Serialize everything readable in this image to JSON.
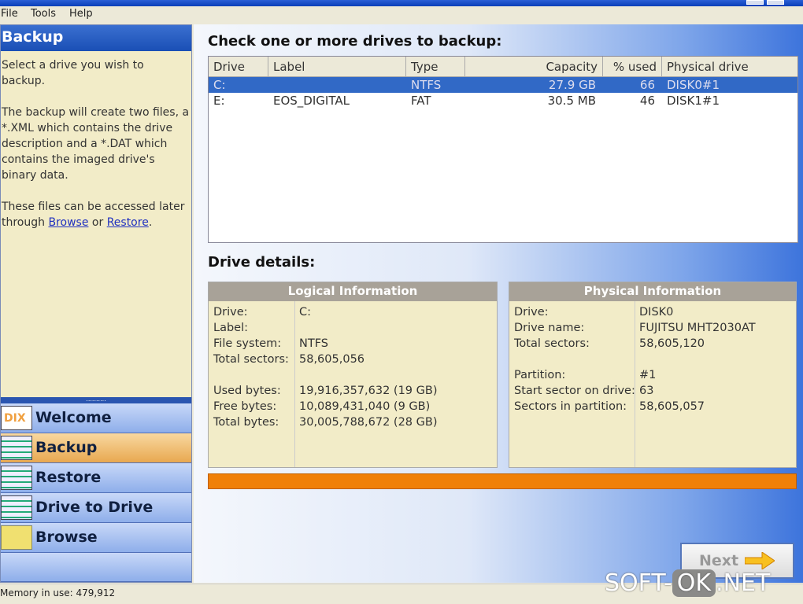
{
  "menu": [
    "File",
    "Tools",
    "Help"
  ],
  "left": {
    "title": "Backup",
    "p1": "Select a drive you wish to backup.",
    "p2": "The backup will create two files, a  *.XML which contains the drive description and a *.DAT which contains the imaged drive's binary data.",
    "p3a": "These files can be accessed later through ",
    "browse": "Browse",
    "or": " or ",
    "restore": "Restore",
    "p3end": "."
  },
  "nav": [
    {
      "label": "Welcome",
      "icon": "dix-logo-icon"
    },
    {
      "label": "Backup",
      "icon": "backup-icon"
    },
    {
      "label": "Restore",
      "icon": "restore-icon"
    },
    {
      "label": "Drive to Drive",
      "icon": "drive-to-drive-icon"
    },
    {
      "label": "Browse",
      "icon": "folder-icon"
    }
  ],
  "nav_icon_text": "DIX",
  "status": "Memory in use: 479,912",
  "main": {
    "heading": "Check one or more drives to backup:",
    "details_heading": "Drive details:",
    "next": "Next"
  },
  "table": {
    "columns": [
      "Drive",
      "Label",
      "Type",
      "Capacity",
      "% used",
      "Physical drive"
    ],
    "rows": [
      [
        "C:",
        "",
        "NTFS",
        "27.9 GB",
        "66",
        "DISK0#1"
      ],
      [
        "E:",
        "EOS_DIGITAL",
        "FAT",
        "30.5 MB",
        "46",
        "DISK1#1"
      ]
    ]
  },
  "logical": {
    "title": "Logical Information",
    "rows": [
      [
        "Drive:",
        "C:"
      ],
      [
        "Label:",
        ""
      ],
      [
        "File system:",
        "NTFS"
      ],
      [
        "Total sectors:",
        "58,605,056"
      ],
      [
        "",
        ""
      ],
      [
        "Used bytes:",
        "19,916,357,632 (19 GB)"
      ],
      [
        "Free bytes:",
        "10,089,431,040 (9 GB)"
      ],
      [
        "Total bytes:",
        "30,005,788,672 (28 GB)"
      ]
    ]
  },
  "physical": {
    "title": "Physical Information",
    "rows": [
      [
        "Drive:",
        "DISK0"
      ],
      [
        "Drive name:",
        "FUJITSU MHT2030AT"
      ],
      [
        "Total sectors:",
        "58,605,120"
      ],
      [
        "",
        ""
      ],
      [
        "Partition:",
        "#1"
      ],
      [
        "Start sector on drive:",
        "63"
      ],
      [
        "Sectors in partition:",
        "58,605,057"
      ]
    ]
  },
  "progress_percent": 100,
  "watermark": {
    "a": "SOFT-",
    "b": "OK",
    ".c": "",
    "c": ".NET"
  }
}
